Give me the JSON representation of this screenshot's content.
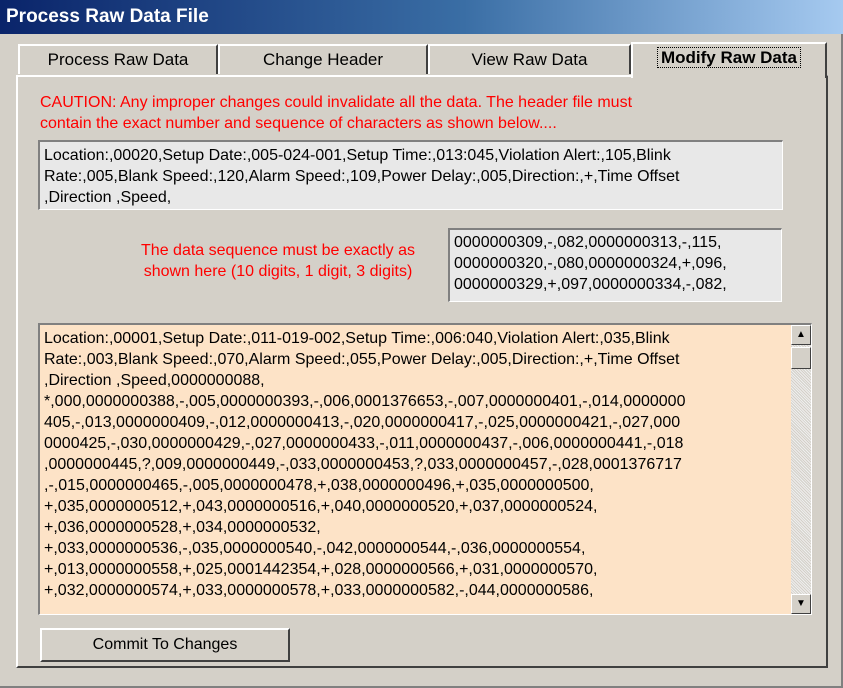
{
  "window": {
    "title": "Process Raw Data File"
  },
  "tabs": [
    {
      "label": "Process Raw Data",
      "active": false
    },
    {
      "label": "Change Header",
      "active": false
    },
    {
      "label": "View Raw Data",
      "active": false
    },
    {
      "label": "Modify Raw Data",
      "active": true
    }
  ],
  "caution": {
    "line1": "CAUTION: Any improper changes could invalidate all the data. The header file must",
    "line2": "contain the exact number and sequence of characters as shown below...."
  },
  "header_example": {
    "lines": [
      "Location:,00020,Setup Date:,005-024-001,Setup Time:,013:045,Violation Alert:,105,Blink",
      "Rate:,005,Blank Speed:,120,Alarm Speed:,109,Power Delay:,005,Direction:,+,Time Offset",
      ",Direction ,Speed,"
    ]
  },
  "sequence": {
    "label_line1": "The data sequence must be exactly as",
    "label_line2": "shown here (10 digits, 1 digit, 3 digits)",
    "example_lines": [
      "0000000309,-,082,0000000313,-,115,",
      "0000000320,-,080,0000000324,+,096,",
      "0000000329,+,097,0000000334,-,082,"
    ]
  },
  "raw_data": {
    "lines": [
      "Location:,00001,Setup Date:,011-019-002,Setup Time:,006:040,Violation Alert:,035,Blink",
      "Rate:,003,Blank Speed:,070,Alarm Speed:,055,Power Delay:,005,Direction:,+,Time Offset",
      ",Direction ,Speed,0000000088,",
      "*,000,0000000388,-,005,0000000393,-,006,0001376653,-,007,0000000401,-,014,0000000",
      "405,-,013,0000000409,-,012,0000000413,-,020,0000000417,-,025,0000000421,-,027,000",
      "0000425,-,030,0000000429,-,027,0000000433,-,011,0000000437,-,006,0000000441,-,018",
      ",0000000445,?,009,0000000449,-,033,0000000453,?,033,0000000457,-,028,0001376717",
      ",-,015,0000000465,-,005,0000000478,+,038,0000000496,+,035,0000000500,",
      "+,035,0000000512,+,043,0000000516,+,040,0000000520,+,037,0000000524,",
      "+,036,0000000528,+,034,0000000532,",
      "+,033,0000000536,-,035,0000000540,-,042,0000000544,-,036,0000000554,",
      "+,013,0000000558,+,025,0001442354,+,028,0000000566,+,031,0000000570,",
      "+,032,0000000574,+,033,0000000578,+,033,0000000582,-,044,0000000586,"
    ]
  },
  "buttons": {
    "commit_label": "Commit To Changes"
  },
  "scrollbar": {
    "up_icon": "arrow-up-icon",
    "down_icon": "arrow-down-icon"
  },
  "colors": {
    "caution_text": "#ff0000",
    "data_background": "#fde3c7",
    "title_gradient_start": "#0a246a",
    "face": "#d4d0c8"
  }
}
